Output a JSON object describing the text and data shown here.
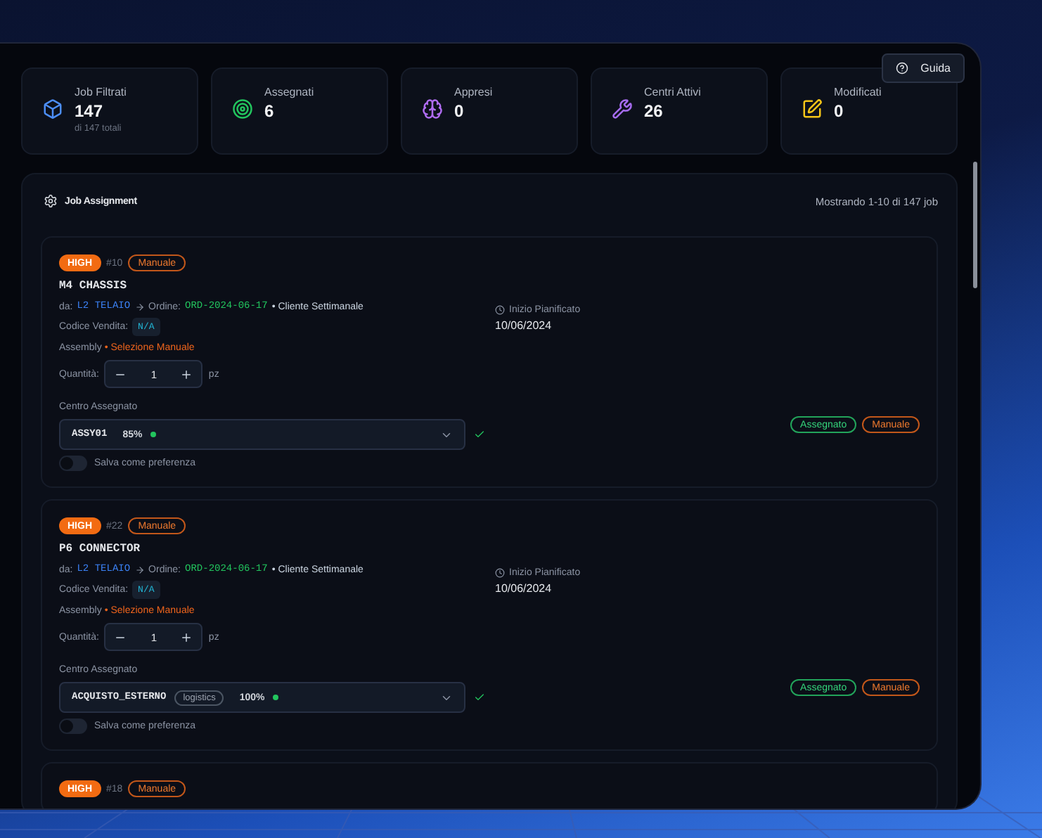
{
  "help_button": {
    "label": "Guida"
  },
  "stats": [
    {
      "kind": "box",
      "label": "Job Filtrati",
      "value": "147",
      "sub": "di 147 totali"
    },
    {
      "kind": "target",
      "label": "Assegnati",
      "value": "6"
    },
    {
      "kind": "brain",
      "label": "Appresi",
      "value": "0"
    },
    {
      "kind": "wrench",
      "label": "Centri Attivi",
      "value": "26"
    },
    {
      "kind": "edit",
      "label": "Modificati",
      "value": "0"
    }
  ],
  "panel": {
    "title": "Job Assignment",
    "summary": "Mostrando 1-10 di 147 job"
  },
  "jobs": [
    {
      "priority": "HIGH",
      "number": "#10",
      "mode": "Manuale",
      "title": "M4 CHASSIS",
      "from_label": "da:",
      "from": "L2 TELAIO",
      "order_label": "Ordine:",
      "order": "ORD-2024-06-17",
      "client": "• Cliente Settimanale",
      "sales_code_label": "Codice Vendita:",
      "sales_code": "N/A",
      "assembly_label": "Assembly",
      "assembly": "• Selezione Manuale",
      "quantity_label": "Quantità:",
      "quantity": "1",
      "unit": "pz",
      "center_label": "Centro Assegnato",
      "center": {
        "code": "ASSY01",
        "percent": "85%"
      },
      "save_pref": {
        "label": "Salva come preferenza",
        "on": false
      },
      "start_label": "Inizio Pianificato",
      "start_date": "10/06/2024",
      "status_badges": [
        {
          "kind": "assigned",
          "label": "Assegnato"
        },
        {
          "kind": "manual",
          "label": "Manuale"
        }
      ]
    },
    {
      "priority": "HIGH",
      "number": "#22",
      "mode": "Manuale",
      "title": "P6 CONNECTOR",
      "from_label": "da:",
      "from": "L2 TELAIO",
      "order_label": "Ordine:",
      "order": "ORD-2024-06-17",
      "client": "• Cliente Settimanale",
      "sales_code_label": "Codice Vendita:",
      "sales_code": "N/A",
      "assembly_label": "Assembly",
      "assembly": "• Selezione Manuale",
      "quantity_label": "Quantità:",
      "quantity": "1",
      "unit": "pz",
      "center_label": "Centro Assegnato",
      "center": {
        "code": "ACQUISTO_ESTERNO",
        "tag": "logistics",
        "percent": "100%"
      },
      "save_pref": {
        "label": "Salva come preferenza",
        "on": false
      },
      "start_label": "Inizio Pianificato",
      "start_date": "10/06/2024",
      "status_badges": [
        {
          "kind": "assigned",
          "label": "Assegnato"
        },
        {
          "kind": "manual",
          "label": "Manuale"
        }
      ]
    },
    {
      "priority": "HIGH",
      "number": "#18",
      "mode": "Manuale"
    }
  ]
}
